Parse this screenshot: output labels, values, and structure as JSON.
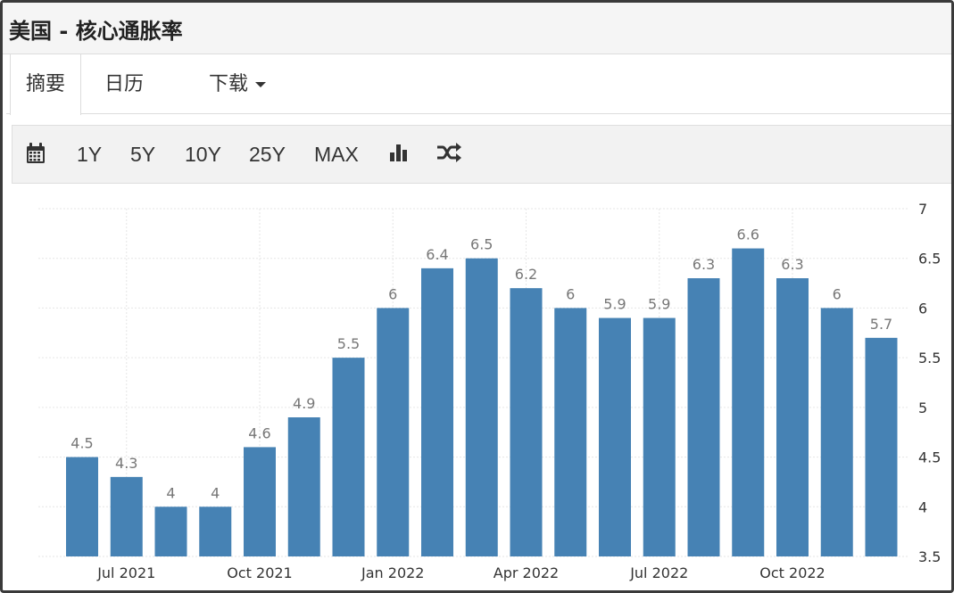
{
  "page": {
    "title": "美国 - 核心通胀率"
  },
  "tabs": [
    {
      "label": "摘要",
      "active": true
    },
    {
      "label": "日历",
      "active": false
    },
    {
      "label": "下载",
      "active": false
    }
  ],
  "toolbar": {
    "calendar_icon": "calendar-icon",
    "ranges": [
      "1Y",
      "5Y",
      "10Y",
      "25Y",
      "MAX"
    ],
    "bar_chart_icon": "bar-chart-icon",
    "shuffle_icon": "shuffle-icon"
  },
  "colors": {
    "bar": "#4682b4",
    "label": "#777777",
    "grid": "#e6e6e6"
  },
  "chart_data": {
    "type": "bar",
    "categories": [
      "Jun 2021",
      "Jul 2021",
      "Aug 2021",
      "Sep 2021",
      "Oct 2021",
      "Nov 2021",
      "Dec 2021",
      "Jan 2022",
      "Feb 2022",
      "Mar 2022",
      "Apr 2022",
      "May 2022",
      "Jun 2022",
      "Jul 2022",
      "Aug 2022",
      "Sep 2022",
      "Oct 2022",
      "Nov 2022",
      "Dec 2022"
    ],
    "values": [
      4.5,
      4.3,
      4,
      4,
      4.6,
      4.9,
      5.5,
      6,
      6.4,
      6.5,
      6.2,
      6,
      5.9,
      5.9,
      6.3,
      6.6,
      6.3,
      6,
      5.7
    ],
    "x_tick_labels": [
      "Jul 2021",
      "Oct 2021",
      "Jan 2022",
      "Apr 2022",
      "Jul 2022",
      "Oct 2022"
    ],
    "y_ticks": [
      "3.5",
      "4",
      "4.5",
      "5",
      "5.5",
      "6",
      "6.5",
      "7"
    ],
    "ylim": [
      3.5,
      7
    ],
    "y_axis_position": "right",
    "grid": true,
    "title": "",
    "xlabel": "",
    "ylabel": ""
  }
}
